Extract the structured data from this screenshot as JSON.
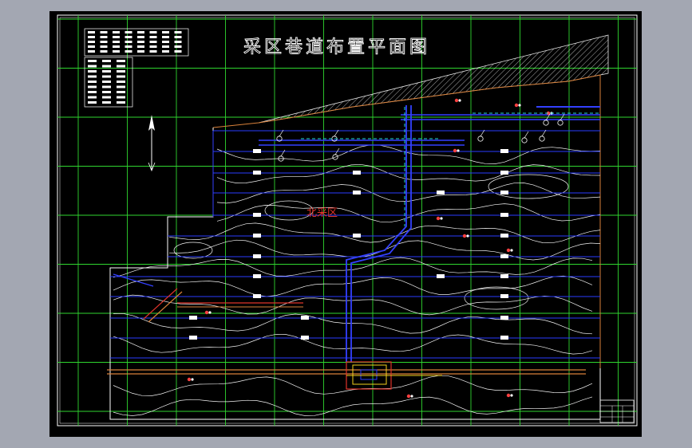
{
  "drawing": {
    "title": "采区巷道布置平面图",
    "zone_label": "北采区"
  },
  "colors": {
    "background": "#000000",
    "viewport_surround": "#a3a7b2",
    "grid": "#2fd62f",
    "roadway": "#2a3bff",
    "contour": "#f4f4f4",
    "boundary": "#d9813a",
    "zone_label": "#e0332a",
    "frame": "#ffffff"
  },
  "icons": {
    "north_arrow": "north-arrow-icon",
    "borehole": "borehole-icon"
  }
}
